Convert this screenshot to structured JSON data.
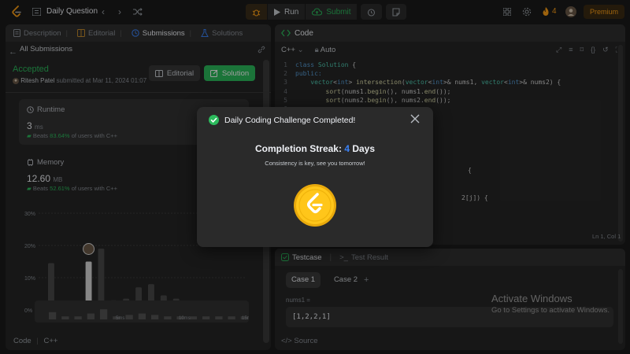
{
  "topbar": {
    "problem_title": "Daily Question",
    "run_label": "Run",
    "submit_label": "Submit",
    "streak_count": "4",
    "premium_label": "Premium"
  },
  "left": {
    "tabs": [
      {
        "label": "Description"
      },
      {
        "label": "Editorial"
      },
      {
        "label": "Submissions"
      },
      {
        "label": "Solutions"
      }
    ],
    "all_submissions": "All Submissions",
    "status": "Accepted",
    "submitter_name": "Ritesh Patel",
    "submitted_text": "submitted at Mar 11, 2024 01:07",
    "editorial_button": "Editorial",
    "solution_button": "Solution",
    "runtime": {
      "title": "Runtime",
      "value": "3",
      "unit": "ms",
      "beats_prefix": "Beats",
      "beats_pct": "83.64%",
      "beats_suffix": "of users with C++"
    },
    "memory": {
      "title": "Memory",
      "value": "12.60",
      "unit": "MB",
      "beats_prefix": "Beats",
      "beats_pct": "52.61%",
      "beats_suffix": "of users with C++"
    },
    "footer_code": "Code",
    "footer_lang": "C++"
  },
  "chart_data": {
    "type": "bar",
    "y_ticks": [
      "30%",
      "20%",
      "10%",
      "0%"
    ],
    "ylim": [
      0,
      30
    ],
    "x_labels": [
      "2ms",
      "4ms",
      "6ms",
      "8ms",
      "10ms",
      "13ms",
      "14ms"
    ],
    "values": [
      14.5,
      0.5,
      2,
      15,
      19,
      3,
      3.5,
      7,
      8,
      4.5,
      3.5,
      2.5,
      2.5,
      2.5,
      2,
      1.5
    ],
    "highlight_index": 3,
    "mini_labels": [
      "5ms",
      "10ms",
      "15ms"
    ],
    "mini_values": [
      40,
      10,
      10,
      30,
      60,
      10,
      20,
      30,
      20,
      10,
      10,
      10,
      10,
      10,
      10,
      10
    ]
  },
  "code": {
    "title": "Code",
    "language": "C++",
    "mode": "Auto",
    "position": "Ln 1, Col 1",
    "lines": [
      "class Solution {",
      "public:",
      "    vector<int> intersection(vector<int>& nums1, vector<int>& nums2) {",
      "        sort(nums1.begin(), nums1.end());",
      "        sort(nums2.begin(), nums2.end());",
      "",
      "",
      "",
      "",
      "",
      "",
      "",
      "",
      "",
      "",
      "",
      ""
    ],
    "fragment_brace": "{",
    "fragment_j": "2[j]) {"
  },
  "test": {
    "tab_testcase": "Testcase",
    "tab_result": "Test Result",
    "case1": "Case 1",
    "case2": "Case 2",
    "add": "+",
    "var_name": "nums1 =",
    "var_value": "[1,2,2,1]",
    "source": "Source"
  },
  "watermark": {
    "title": "Activate Windows",
    "subtitle": "Go to Settings to activate Windows."
  },
  "modal": {
    "title": "Daily Coding Challenge Completed!",
    "streak_prefix": "Completion Streak:",
    "streak_num": "4",
    "streak_suffix": "Days",
    "subtitle": "Consistency is key, see you tomorrow!"
  },
  "colors": {
    "accent_green": "#2cbb5d",
    "accent_orange": "#ffa116",
    "streak_blue": "#3b82f6"
  }
}
